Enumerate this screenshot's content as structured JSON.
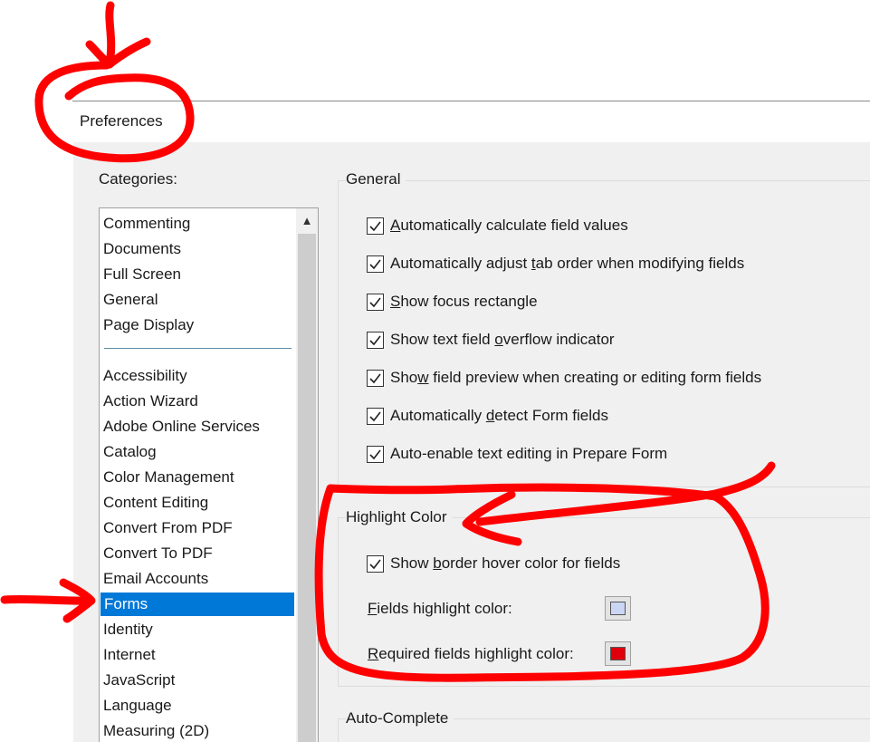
{
  "window": {
    "title": "Preferences"
  },
  "categories": {
    "label": "Categories:",
    "top_items": [
      "Commenting",
      "Documents",
      "Full Screen",
      "General",
      "Page Display"
    ],
    "items": [
      "Accessibility",
      "Action Wizard",
      "Adobe Online Services",
      "Catalog",
      "Color Management",
      "Content Editing",
      "Convert From PDF",
      "Convert To PDF",
      "Email Accounts",
      "Forms",
      "Identity",
      "Internet",
      "JavaScript",
      "Language",
      "Measuring (2D)"
    ],
    "selected": "Forms",
    "scroll_up_icon": "▲"
  },
  "general": {
    "title": "General",
    "options": [
      {
        "pre": "",
        "u": "A",
        "post": "utomatically calculate field values",
        "checked": true
      },
      {
        "pre": "Automatically adjust ",
        "u": "t",
        "post": "ab order when modifying fields",
        "checked": true
      },
      {
        "pre": "",
        "u": "S",
        "post": "how focus rectangle",
        "checked": true
      },
      {
        "pre": "Show text field ",
        "u": "o",
        "post": "verflow indicator",
        "checked": true
      },
      {
        "pre": "Sho",
        "u": "w",
        "post": " field preview when creating or editing form fields",
        "checked": true
      },
      {
        "pre": "Automatically ",
        "u": "d",
        "post": "etect Form fields",
        "checked": true
      },
      {
        "pre": "Auto-enable text editing in Prepare Form",
        "u": "",
        "post": "",
        "checked": true
      }
    ]
  },
  "highlight": {
    "title": "Highlight Color",
    "border_hover": {
      "pre": "Show ",
      "u": "b",
      "post": "order hover color for fields",
      "checked": true
    },
    "fields_color": {
      "u": "F",
      "post": "ields highlight color:",
      "color": "#cbd6f5"
    },
    "required_color": {
      "u": "R",
      "post": "equired fields highlight color:",
      "color": "#e0000b"
    }
  },
  "autocomplete": {
    "title": "Auto-Complete"
  },
  "colors": {
    "accent": "#0078d7",
    "annotation": "#ff0000"
  }
}
